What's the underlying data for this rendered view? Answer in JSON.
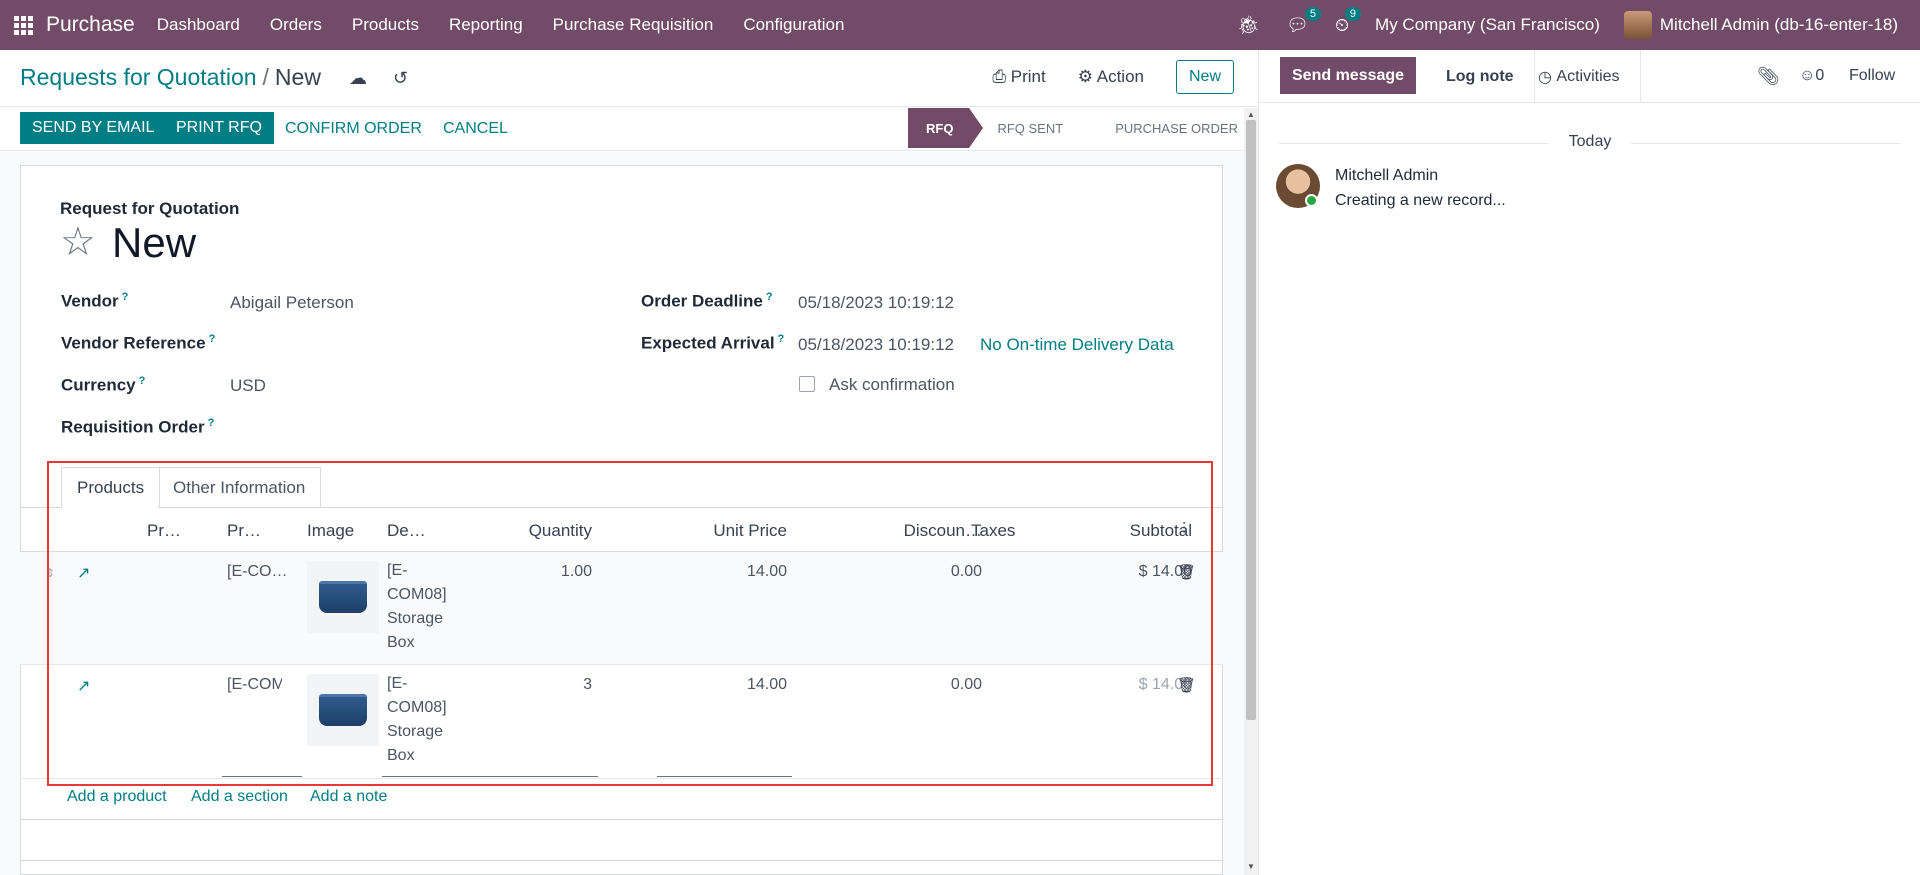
{
  "topnav": {
    "brand": "Purchase",
    "menu": [
      "Dashboard",
      "Orders",
      "Products",
      "Reporting",
      "Purchase Requisition",
      "Configuration"
    ],
    "messages_badge": "5",
    "activities_badge": "9",
    "company": "My Company (San Francisco)",
    "user": "Mitchell Admin (db-16-enter-18)"
  },
  "control_panel": {
    "breadcrumb_parent": "Requests for Quotation",
    "breadcrumb_sep": "/",
    "breadcrumb_current": "New",
    "print": "Print",
    "action": "Action",
    "new_button": "New"
  },
  "statusbar": {
    "send_by_email": "SEND BY EMAIL",
    "print_rfq": "PRINT RFQ",
    "confirm_order": "CONFIRM ORDER",
    "cancel": "CANCEL",
    "stages": [
      "RFQ",
      "RFQ SENT",
      "PURCHASE ORDER"
    ],
    "active_stage": "RFQ"
  },
  "form": {
    "subtitle": "Request for Quotation",
    "record_name": "New",
    "vendor_label": "Vendor",
    "vendor_value": "Abigail Peterson",
    "vendor_ref_label": "Vendor Reference",
    "currency_label": "Currency",
    "currency_value": "USD",
    "requisition_label": "Requisition Order",
    "order_deadline_label": "Order Deadline",
    "order_deadline_value": "05/18/2023 10:19:12",
    "expected_arrival_label": "Expected Arrival",
    "expected_arrival_value": "05/18/2023 10:19:12",
    "on_time_delivery": "No On-time Delivery Data",
    "ask_confirmation_label": "Ask confirmation",
    "help_mark": "?"
  },
  "tabs": [
    "Products",
    "Other Information"
  ],
  "table": {
    "headers": [
      "Pr…",
      "Pr…",
      "Image",
      "De…",
      "Quantity",
      "Unit Price",
      "Discoun…",
      "Taxes",
      "Subtotal"
    ],
    "rows": [
      {
        "product": "[E-CO…",
        "description": [
          "[E-",
          "COM08]",
          "Storage",
          "Box"
        ],
        "quantity": "1.00",
        "unit_price": "14.00",
        "discount": "0.00",
        "subtotal": "$ 14.00"
      },
      {
        "product": "[E-COM",
        "description": [
          "[E-",
          "COM08]",
          "Storage",
          "Box"
        ],
        "quantity": "3",
        "unit_price": "14.00",
        "discount": "0.00",
        "subtotal": "$ 14.00"
      }
    ],
    "add_product": "Add a product",
    "add_section": "Add a section",
    "add_note": "Add a note"
  },
  "chatter": {
    "send_message": "Send message",
    "log_note": "Log note",
    "activities": "Activities",
    "followers_count": "0",
    "follow": "Follow",
    "date_separator": "Today",
    "message_author": "Mitchell Admin",
    "message_body": "Creating a new record..."
  },
  "colors": {
    "brand": "#714b67",
    "accent": "#017e84",
    "highlight": "#e53935"
  }
}
